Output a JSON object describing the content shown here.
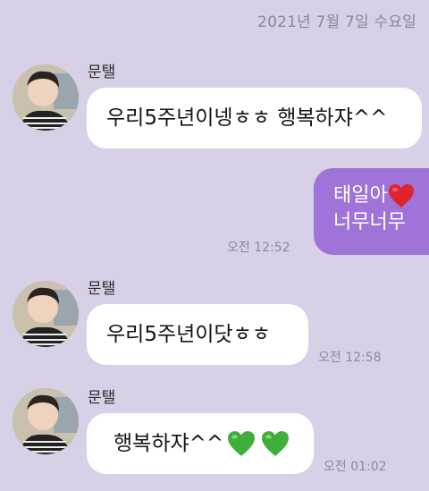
{
  "date_divider": "2021년 7월 7일 수요일",
  "contact_name": "문탤",
  "messages": [
    {
      "sender": "문탤",
      "text": "우리5주년이넹ㅎㅎ 행복하쟈^^"
    },
    {
      "from_me": true,
      "line1": "태일아",
      "line2": "너무너무 ",
      "time": "오전 12:52"
    },
    {
      "sender": "문탤",
      "text": "우리5주년이닷ㅎㅎ",
      "time": "오전 12:58"
    },
    {
      "sender": "문탤",
      "text": "행복하쟈^^",
      "time": "오전 01:02"
    }
  ],
  "emoji": {
    "red_heart": "❤️",
    "green_heart": "💚"
  },
  "colors": {
    "background": "#d8d0e6",
    "my_bubble": "#9f73d8",
    "their_bubble": "#ffffff",
    "timestamp": "#8e879a"
  }
}
